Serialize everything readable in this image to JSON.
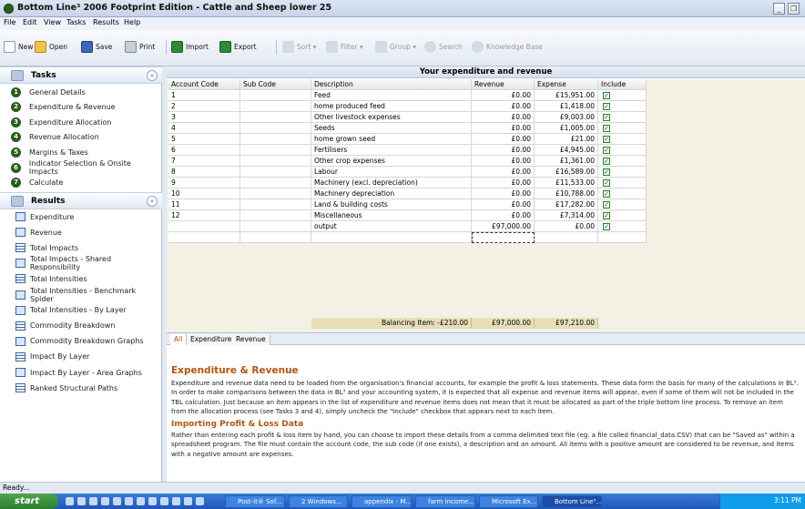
{
  "window": {
    "title": "Bottom Line³ 2006 Footprint Edition - Cattle and Sheep lower 25"
  },
  "menu": [
    "File",
    "Edit",
    "View",
    "Tasks",
    "Results",
    "Help"
  ],
  "toolbar": {
    "new": "New",
    "open": "Open",
    "save": "Save",
    "print": "Print",
    "import": "Import",
    "export": "Export",
    "sort": "Sort",
    "filter": "Filter",
    "group": "Group",
    "search": "Search",
    "kb": "Knowledge Base"
  },
  "tasks": {
    "header": "Tasks",
    "items": [
      "General Details",
      "Expenditure & Revenue",
      "Expenditure Allocation",
      "Revenue Allocation",
      "Margins & Taxes",
      "Indicator Selection & Onsite Impacts",
      "Calculate"
    ]
  },
  "results": {
    "header": "Results",
    "items": [
      "Expenditure",
      "Revenue",
      "Total Impacts",
      "Total Impacts - Shared Responsibility",
      "Total Intensities",
      "Total Intensities - Benchmark Spider",
      "Total Intensities - By Layer",
      "Commodity Breakdown",
      "Commodity Breakdown Graphs",
      "Impact By Layer",
      "Impact By Layer - Area Graphs",
      "Ranked Structural Paths"
    ],
    "icons": [
      "chart",
      "chart",
      "table",
      "chart",
      "table",
      "chart",
      "chart",
      "table",
      "chart",
      "table",
      "chart",
      "table"
    ]
  },
  "grid": {
    "title": "Your expenditure and revenue",
    "columns": [
      "Account Code",
      "Sub Code",
      "Description",
      "Revenue",
      "Expense",
      "Include"
    ],
    "rows": [
      {
        "code": "1",
        "sub": "",
        "desc": "Feed",
        "rev": "£0.00",
        "exp": "£15,951.00",
        "inc": true
      },
      {
        "code": "2",
        "sub": "",
        "desc": "home produced feed",
        "rev": "£0.00",
        "exp": "£1,418.00",
        "inc": true
      },
      {
        "code": "3",
        "sub": "",
        "desc": "Other livestock expenses",
        "rev": "£0.00",
        "exp": "£9,003.00",
        "inc": true
      },
      {
        "code": "4",
        "sub": "",
        "desc": "Seeds",
        "rev": "£0.00",
        "exp": "£1,005.00",
        "inc": true
      },
      {
        "code": "5",
        "sub": "",
        "desc": "home grown seed",
        "rev": "£0.00",
        "exp": "£21.00",
        "inc": true
      },
      {
        "code": "6",
        "sub": "",
        "desc": "Fertilisers",
        "rev": "£0.00",
        "exp": "£4,945.00",
        "inc": true
      },
      {
        "code": "7",
        "sub": "",
        "desc": "Other crop expenses",
        "rev": "£0.00",
        "exp": "£1,361.00",
        "inc": true
      },
      {
        "code": "8",
        "sub": "",
        "desc": "Labour",
        "rev": "£0.00",
        "exp": "£16,589.00",
        "inc": true
      },
      {
        "code": "9",
        "sub": "",
        "desc": "Machinery (excl. depreciation)",
        "rev": "£0.00",
        "exp": "£11,533.00",
        "inc": true
      },
      {
        "code": "10",
        "sub": "",
        "desc": "Machinery depreciation",
        "rev": "£0.00",
        "exp": "£10,788.00",
        "inc": true
      },
      {
        "code": "11",
        "sub": "",
        "desc": "Land & building costs",
        "rev": "£0.00",
        "exp": "£17,282.00",
        "inc": true
      },
      {
        "code": "12",
        "sub": "",
        "desc": "Miscellaneous",
        "rev": "£0.00",
        "exp": "£7,314.00",
        "inc": true
      },
      {
        "code": "",
        "sub": "",
        "desc": "output",
        "rev": "£97,000.00",
        "exp": "£0.00",
        "inc": true
      }
    ],
    "footer": {
      "balancing": "Balancing Item: -£210.00",
      "rev": "£97,000.00",
      "exp": "£97,210.00"
    }
  },
  "tabs": [
    "All",
    "Expenditure",
    "Revenue"
  ],
  "help": {
    "h1": "Expenditure & Revenue",
    "p1": "Expenditure and revenue data need to be loaded from the organisation's financial accounts, for example the profit & loss statements. These data form the basis for many of the calculations in BL³. In order to make comparisons between the data in BL³ and your accounting system, it is expected that all expense and revenue items will appear, even if some of them will not be included in the TBL calculation. Just because an item appears in the list of expenditure and revenue items does not mean that it must be allocated as part of the triple bottom line process. To remove an item from the allocation process (see Tasks 3 and 4), simply uncheck the \"Include\" checkbox that appears next to each item.",
    "h2": "Importing Profit & Loss Data",
    "p2": "Rather than entering each profit & loss item by hand, you can choose to import these details from a comma delimited text file (eg. a file called financial_data.CSV) that can be \"Saved as\" within a spreadsheet program. The file must contain the account code, the sub code (if one exists), a description and an amount. All items with a positive amount are considered to be revenue, and items with a negative amount are expenses."
  },
  "status": "Ready...",
  "taskbar": {
    "start": "start",
    "buttons": [
      "Post-it® Sof...",
      "2 Windows...",
      "appendix - M...",
      "farm income...",
      "Microsoft Ex...",
      "Bottom Line³..."
    ],
    "clock": "3:11 PM"
  },
  "colors": {
    "accent": "#b4560f",
    "task_icon": "#285d1c",
    "taskbar": "#1f57b8"
  }
}
